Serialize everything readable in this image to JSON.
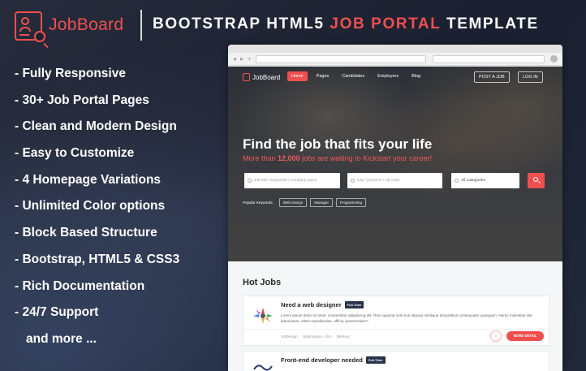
{
  "header": {
    "brand": "JobBoard",
    "tagline_part1": "BOOTSTRAP HTML5 ",
    "tagline_accent": "JOB PORTAL",
    "tagline_part2": " TEMPLATE",
    "accent_color": "#ef4f4f"
  },
  "features": [
    "- Fully Responsive",
    "- 30+  Job Portal Pages",
    "- Clean and Modern Design",
    "- Easy to Customize",
    "- 4 Homepage Variations",
    "- Unlimited Color options",
    "- Block Based Structure",
    "- Bootstrap, HTML5 & CSS3",
    "- Rich Documentation",
    "- 24/7 Support",
    "and more ..."
  ],
  "browser": {
    "back_icon": "◂",
    "forward_icon": "▸",
    "new_tab": "+"
  },
  "site": {
    "logo": "JobBoard",
    "nav": [
      "Home",
      "Pages",
      "Candidates",
      "Employers",
      "Blog"
    ],
    "post_job": "POST A JOB",
    "login": "LOG IN",
    "hero_title": "Find the job that fits your life",
    "hero_sub_pre": "More than ",
    "hero_sub_count": "12,000",
    "hero_sub_post": " jobs are waiting to Kickstart your career!",
    "search_keyword_placeholder": "Job title / keywords / company name",
    "search_location_placeholder": "City / province / zip code",
    "search_category": "All Categories",
    "popular_label": "Popular Keywords:",
    "keywords": [
      "Web Design",
      "Manager",
      "Programming"
    ],
    "hot_jobs_title": "Hot Jobs",
    "jobs": [
      {
        "title": "Need a web designer",
        "type": "Full-Time",
        "desc": "Lorem ipsum dolor sit amet, consectetur adipisicing elit. Rem quaerat sed eius aliquae similique tempotibus consequater quisquam. Nemo molestiae iste laboriosam, ullam repudiandae, officia, praesentium?",
        "company": "ArtiDesign",
        "location": "Washington, USA",
        "salary": "$5/Hour",
        "detail_btn": "MORE DETAIL"
      },
      {
        "title": "Front-end developer needed",
        "type": "Full-Time"
      }
    ]
  }
}
